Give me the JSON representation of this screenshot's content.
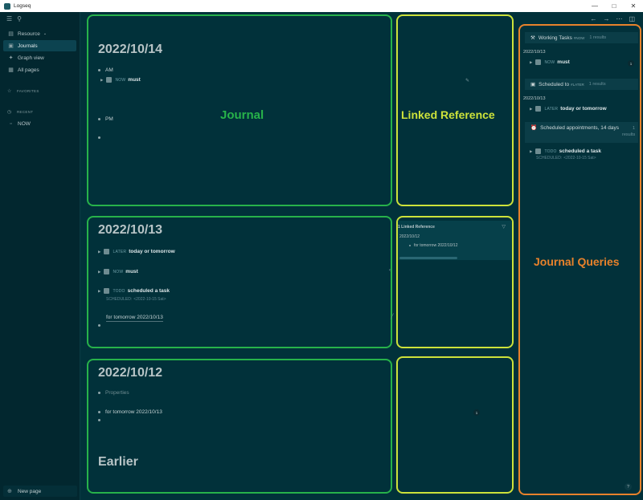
{
  "window": {
    "title": "Logseq"
  },
  "sidebar": {
    "items": [
      {
        "label": "Resource",
        "icon": "folder-icon"
      },
      {
        "label": "Journals",
        "icon": "calendar-icon"
      },
      {
        "label": "Graph view",
        "icon": "graph-icon"
      },
      {
        "label": "All pages",
        "icon": "pages-icon"
      }
    ],
    "favorites_label": "FAVORITES",
    "recent_label": "RECENT",
    "recent_items": [
      "NOW"
    ],
    "new_page_label": "New page"
  },
  "journals": [
    {
      "date": "2022/10/14",
      "blocks": {
        "am": "AM",
        "am_child_marker": "NOW",
        "am_child_text": "must",
        "pm": "PM"
      }
    },
    {
      "date": "2022/10/13",
      "blocks": {
        "later_marker": "LATER",
        "later_text": "today or tomorrow",
        "now_marker": "NOW",
        "now_text": "must",
        "todo_marker": "TODO",
        "todo_text": "scheduled a task",
        "scheduled_label": "SCHEDULED:",
        "scheduled_value": "<2022-10-15 Sat>",
        "link_text": "for tomorrow 2022/10/13"
      }
    },
    {
      "date": "2022/10/12",
      "blocks": {
        "properties": "Properties",
        "link_text": "for tomorrow 2022/10/13"
      }
    }
  ],
  "earlier_label": "Earlier",
  "linked_refs": {
    "header": "1 Linked Reference",
    "page": "2022/10/12",
    "item": "for tomorrow 2022/10/12",
    "badge_count": "1"
  },
  "queries": [
    {
      "title": "Working Tasks",
      "tag": "#NOW",
      "results": "1 results",
      "date": "2022/10/13",
      "marker": "NOW",
      "text": "must",
      "count": "1"
    },
    {
      "title": "Scheduled to",
      "tag": "#LATER",
      "results": "1 results",
      "date": "2022/10/13",
      "marker": "LATER",
      "text": "today or tomorrow"
    },
    {
      "title": "Scheduled appointments, 14 days",
      "results": "1 results",
      "marker": "TODO",
      "text": "scheduled a task",
      "scheduled_label": "SCHEDULED:",
      "scheduled_value": "<2022-10-15 Sat>"
    }
  ],
  "overlays": {
    "journal": "Journal",
    "linked_reference": "Linked Reference",
    "journal_queries": "Journal Queries"
  },
  "colors": {
    "journal_frame": "#27b24a",
    "linked_reference_frame": "#cde23a",
    "queries_frame": "#e9822b"
  },
  "help_label": "?"
}
